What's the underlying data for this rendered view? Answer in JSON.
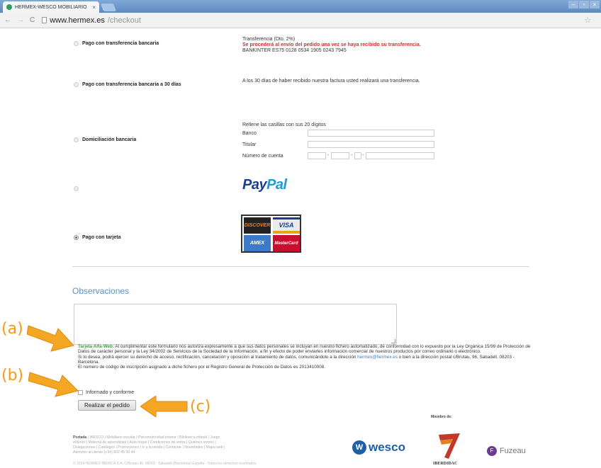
{
  "browser": {
    "tab_title": "HERMEX-WESCO MOBILIARIO",
    "tab_close": "×",
    "url_host": "www.hermex.es",
    "url_path": "/checkout"
  },
  "payment": {
    "transfer_label": "Pago con transferencia bancaria",
    "transfer_desc_1": "Transferencia (Dto. 2%)",
    "transfer_desc_warning": "Se procederá al envío del pedido una vez se haya recibido su transferencia.",
    "transfer_desc_iban": "BANKINTER ES75 0128 0534 1905 0243 7945",
    "transfer30_label": "Pago con transferencia bancaria a 30 días",
    "transfer30_desc": "A los 30 días de haber recibido nuestra factura usted realizará una transferencia.",
    "direct_debit_label": "Domiciliación bancaria",
    "direct_debit_hint": "Rellene las casillas con sus 20 dígitos",
    "field_banco": "Banco",
    "field_titular": "Titular",
    "field_cuenta": "Número de cuenta",
    "account_separator": "-",
    "paypal_pay": "Pay",
    "paypal_pal": "Pal",
    "card_label": "Pago con tarjeta",
    "card_logos": [
      "DISCOVER",
      "VISA",
      "AMERICAN EXPRESS",
      "MasterCard"
    ]
  },
  "observaciones": {
    "title": "Observaciones"
  },
  "legal": {
    "brand": "Tarjeta Alfa-Web:",
    "text_1": " Al cumplimentar este formulario nos autoriza expresamente a que sus datos personales se incluyan en nuestro fichero automatizado, de conformidad con lo expuesto por la Ley Orgánica 15/99 de Protección de Datos de carácter personal y la Ley 34/2002 de Servicios de la Sociedad de la Información, a fin y efecto de poder enviarles información comercial de nuestros productos por correo ordinario o electrónico.",
    "text_2": "Si lo desea, podrá ejercer su derecho de acceso, rectificación, cancelación y oposición al tratamiento de datos, comunicándolo a la dirección ",
    "email": "hermex@hermex.es",
    "text_3": " o bien a la dirección postal c/Brutau, 96, Sabadell, 08203 - Barcelona.",
    "text_4": "El número de código de inscripción asignado a dicho fichero por el Registro General de Protección de Datos es 2013410008."
  },
  "form": {
    "agree_label": "Informado y conforme",
    "submit_label": "Realizar el pedido"
  },
  "callouts": {
    "a": "(a)",
    "b": "(b)",
    "c": "(c)",
    "color": "#f39c12"
  },
  "footer": {
    "portada": "Portada",
    "links_line1": " | WESCO | Mobiliario escolar | Psicomotricidad interior | Biblioteca infantil | Juego",
    "links_line2": "exterior | Material de aprendizaje | Aula hogar | Condiciones de venta | Quiénes somos |",
    "links_line3": "Delegaciones | Catálogos | Promociones | Ir a la tienda | Contactar | Novedades | Mapa web |",
    "links_line4": "Atención al cliente (+34) 902 45 00 44",
    "copyright": "© 2014 HERMEX IBÉRICA S.A. C/Brutau 96, 08203 - Sabadell (Barcelona) España - Todos los derechos reservados",
    "miembro": "Miembro de:",
    "wesco": "wesco",
    "iberdidac": "IBERDIDAC",
    "fuzeau": "Fuzeau"
  }
}
